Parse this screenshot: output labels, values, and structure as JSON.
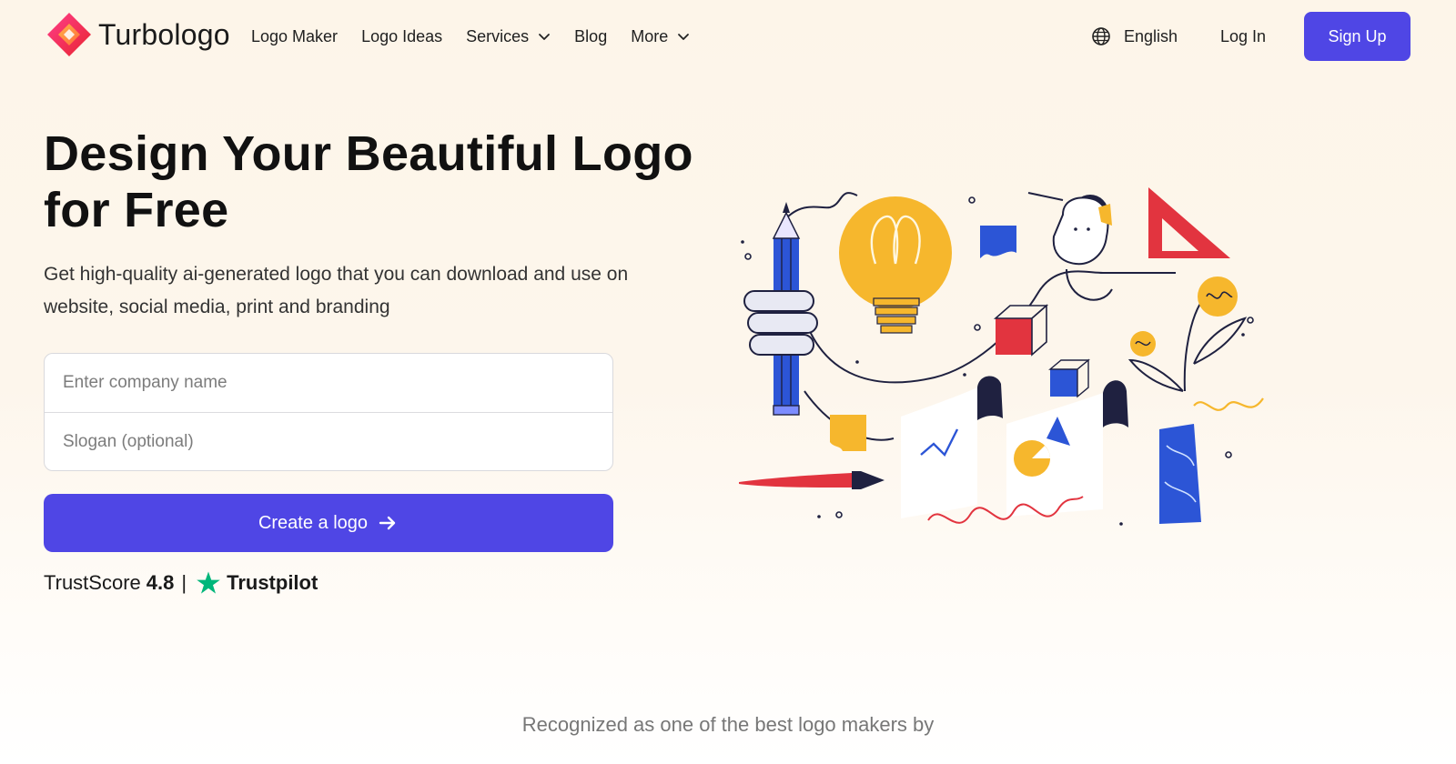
{
  "header": {
    "brand": "Turbologo",
    "nav": [
      {
        "label": "Logo Maker",
        "has_dropdown": false
      },
      {
        "label": "Logo Ideas",
        "has_dropdown": false
      },
      {
        "label": "Services",
        "has_dropdown": true
      },
      {
        "label": "Blog",
        "has_dropdown": false
      },
      {
        "label": "More",
        "has_dropdown": true
      }
    ],
    "language": "English",
    "login_label": "Log In",
    "signup_label": "Sign Up"
  },
  "hero": {
    "title": "Design Your Beautiful Logo for Free",
    "subtitle": "Get high-quality ai-generated logo that you can download and use on website, social media, print and branding",
    "company_placeholder": "Enter company name",
    "slogan_placeholder": "Slogan (optional)",
    "cta_label": "Create a logo",
    "trust_label": "TrustScore",
    "trust_score": "4.8",
    "trust_separator": "|",
    "trustpilot": "Trustpilot"
  },
  "recognized": "Recognized as one of the best logo makers by",
  "colors": {
    "primary": "#4f46e5",
    "trustpilot_green": "#00b67a",
    "background": "#fdf5e9",
    "illustration_blue": "#2c55d6",
    "illustration_yellow": "#f6b72d",
    "illustration_red": "#e2343f"
  },
  "icons": {
    "logo": "turbologo-diamond-icon",
    "globe": "globe-icon",
    "dropdown": "chevron-down-icon",
    "cta": "arrow-right-icon",
    "trust": "trustpilot-star-icon"
  }
}
